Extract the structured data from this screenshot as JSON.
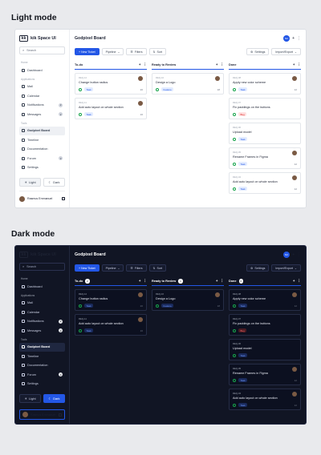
{
  "sections": {
    "light": "Light mode",
    "dark": "Dark mode"
  },
  "app": {
    "logo_mark": "kk",
    "brand": "kik Space UI",
    "search_placeholder": "Search",
    "board_title": "Godpixel Board",
    "user_name": "Rasmus Emmanuel",
    "user_initials": "NC"
  },
  "sidebar": {
    "groups": [
      {
        "label": "Home",
        "items": [
          {
            "label": "Dashboard",
            "badge": ""
          }
        ]
      },
      {
        "label": "Applications",
        "items": [
          {
            "label": "Mail",
            "badge": ""
          },
          {
            "label": "Calendar",
            "badge": ""
          },
          {
            "label": "Notifications",
            "badge": "2"
          },
          {
            "label": "Messages",
            "badge": "2"
          }
        ]
      },
      {
        "label": "Tools",
        "items": [
          {
            "label": "Godpixel Board",
            "badge": "",
            "active": true
          },
          {
            "label": "Timeline",
            "badge": ""
          },
          {
            "label": "Documentation",
            "badge": ""
          },
          {
            "label": "Forum",
            "badge": "3"
          },
          {
            "label": "Settings",
            "badge": ""
          }
        ]
      }
    ],
    "theme_light": "Light",
    "theme_dark": "Dark"
  },
  "toolbar": {
    "new_ticket": "+ New Ticket",
    "pipeline": "Pipeline",
    "filters": "Filters",
    "sort": "Sort",
    "settings": "Settings",
    "import_export": "Import/Export"
  },
  "columns": [
    {
      "title": "To-do",
      "count": "2",
      "cards": [
        {
          "id": "REQ-12",
          "title": "Change button radius",
          "tag": "Task",
          "tag_type": "task",
          "num": "20",
          "avatar": true
        },
        {
          "id": "REQ-11",
          "title": "Add auto layout on whole section",
          "tag": "Task",
          "tag_type": "task",
          "num": "16",
          "avatar": true
        }
      ]
    },
    {
      "title": "Ready to Review",
      "count": "1",
      "cards": [
        {
          "id": "REQ-10",
          "title": "Design a Logo",
          "tag": "Feature",
          "tag_type": "feature",
          "num": "18",
          "avatar": true
        }
      ]
    },
    {
      "title": "Done",
      "count": "6",
      "cards": [
        {
          "id": "REQ-08",
          "title": "Apply new color scheme",
          "tag": "Task",
          "tag_type": "task",
          "num": "12",
          "avatar": true
        },
        {
          "id": "REQ-07",
          "title": "Fix paddings on the buttons",
          "tag": "Bug",
          "tag_type": "bug",
          "num": "",
          "avatar": false
        },
        {
          "id": "REQ-06",
          "title": "Upload model",
          "tag": "Task",
          "tag_type": "task",
          "num": "",
          "avatar": false
        },
        {
          "id": "REQ-05",
          "title": "Rename Frames in Figma",
          "tag": "Task",
          "tag_type": "task",
          "num": "12",
          "avatar": true
        },
        {
          "id": "REQ-04",
          "title": "Add auto layout on whole section",
          "tag": "Task",
          "tag_type": "task",
          "num": "12",
          "avatar": true
        }
      ]
    }
  ]
}
